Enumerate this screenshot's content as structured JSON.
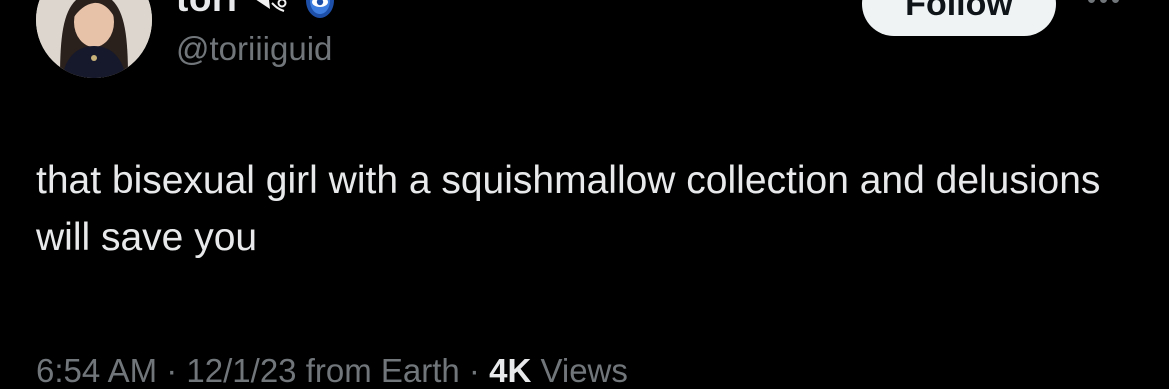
{
  "user": {
    "display_name": "tori",
    "handle": "@toriiiguid",
    "emoji_icon": "bouquet-emoji-icon",
    "verified_icon": "hamsa-eye-icon",
    "accent_color": "#1d9bf0"
  },
  "actions": {
    "follow_label": "Follow",
    "more_icon": "more-dots-icon"
  },
  "tweet": {
    "text": "that bisexual girl with a squishmallow collection and delusions will save you"
  },
  "meta": {
    "time": "6:54 AM",
    "separator": "·",
    "date": "12/1/23",
    "source": "from Earth",
    "views_count": "4K",
    "views_label": "Views"
  }
}
